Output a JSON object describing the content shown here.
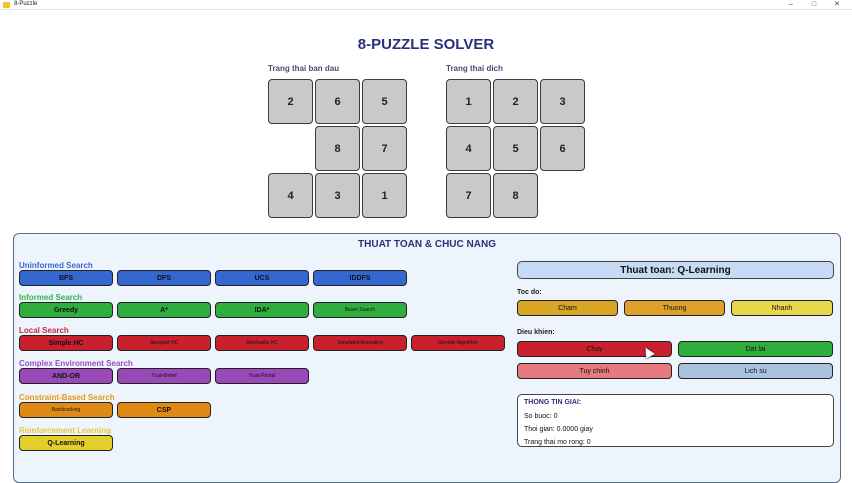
{
  "window": {
    "title": "8-Puzzle"
  },
  "title": "8-PUZZLE SOLVER",
  "initial_state": {
    "label": "Trang thai ban dau",
    "tiles": [
      "2",
      "6",
      "5",
      "",
      "8",
      "7",
      "4",
      "3",
      "1"
    ]
  },
  "goal_state": {
    "label": "Trang thai dich",
    "tiles": [
      "1",
      "2",
      "3",
      "4",
      "5",
      "6",
      "7",
      "8",
      ""
    ]
  },
  "panel": {
    "title": "THUAT TOAN & CHUC NANG",
    "categories": [
      {
        "label": "Uninformed Search",
        "color": "#3a66d6",
        "buttons": [
          "BFS",
          "DFS",
          "UCS",
          "IDDFS"
        ],
        "btn_color": "#3467cf"
      },
      {
        "label": "Informed Search",
        "color": "#32b44a",
        "buttons": [
          "Greedy",
          "A*",
          "IDA*",
          "Beam Search"
        ],
        "btn_color": "#2fae3e"
      },
      {
        "label": "Local Search",
        "color": "#c9283a",
        "buttons": [
          "Simple HC",
          "Steepest HC",
          "Stochastic HC",
          "Simulated Annealing",
          "Genetic Algorithm"
        ],
        "btn_color": "#c8202d"
      },
      {
        "label": "Complex Environment Search",
        "color": "#9b4bc2",
        "buttons": [
          "AND-OR",
          "Trust-Belief",
          "Trust-Partial"
        ],
        "btn_color": "#9a4ab8"
      },
      {
        "label": "Constraint-Based Search",
        "color": "#e69a1a",
        "buttons": [
          "Backtracking",
          "CSP"
        ],
        "btn_color": "#e08a16"
      },
      {
        "label": "Reinforcement Learning",
        "color": "#e5c83a",
        "buttons": [
          "Q-Learning"
        ],
        "btn_color": "#e3cf2c"
      }
    ]
  },
  "info": {
    "selected_algorithm": "Thuat toan: Q-Learning",
    "speed_label": "Toc do:",
    "speed_buttons": [
      "Cham",
      "Thuong",
      "Nhanh"
    ],
    "control_label": "Dieu khien:",
    "control_buttons": [
      "Chay",
      "Dat lai",
      "Tuy chinh",
      "Lich su"
    ],
    "result_title": "THONG TIN GIAI:",
    "steps": "So buoc: 0",
    "time": "Thoi gian: 0.0000 giay",
    "expanded": "Trang thai mo rong: 0"
  },
  "colors": {
    "title": "#2b2f7a",
    "speed_slow": "#d9a626",
    "speed_normal": "#e0a12a",
    "speed_fast": "#ead64a",
    "run": "#c8202d",
    "reset": "#2fae3e",
    "custom": "#e57a80",
    "history": "#a9c2e0",
    "tile": "#c9c9c9"
  }
}
